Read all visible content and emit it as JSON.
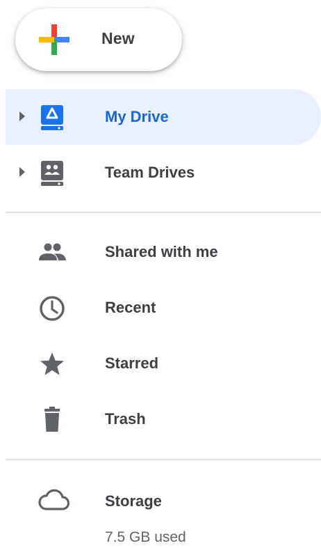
{
  "new_button": {
    "label": "New",
    "icon": "multicolor-plus-icon",
    "colors": {
      "red": "#ea4335",
      "blue": "#4285f4",
      "green": "#34a853",
      "yellow": "#fbbc05"
    }
  },
  "nav": {
    "drives": [
      {
        "label": "My Drive",
        "icon": "my-drive-icon",
        "active": true
      },
      {
        "label": "Team Drives",
        "icon": "team-drives-icon",
        "active": false
      }
    ],
    "sections": [
      {
        "label": "Shared with me",
        "icon": "people-icon"
      },
      {
        "label": "Recent",
        "icon": "clock-icon"
      },
      {
        "label": "Starred",
        "icon": "star-icon"
      },
      {
        "label": "Trash",
        "icon": "trash-icon"
      }
    ]
  },
  "storage": {
    "label": "Storage",
    "icon": "cloud-icon",
    "used": "7.5 GB used"
  },
  "colors": {
    "accent": "#1967d2",
    "active_bg": "#e8f0fe",
    "icon_gray": "#5f6368",
    "text": "#3c4043"
  }
}
